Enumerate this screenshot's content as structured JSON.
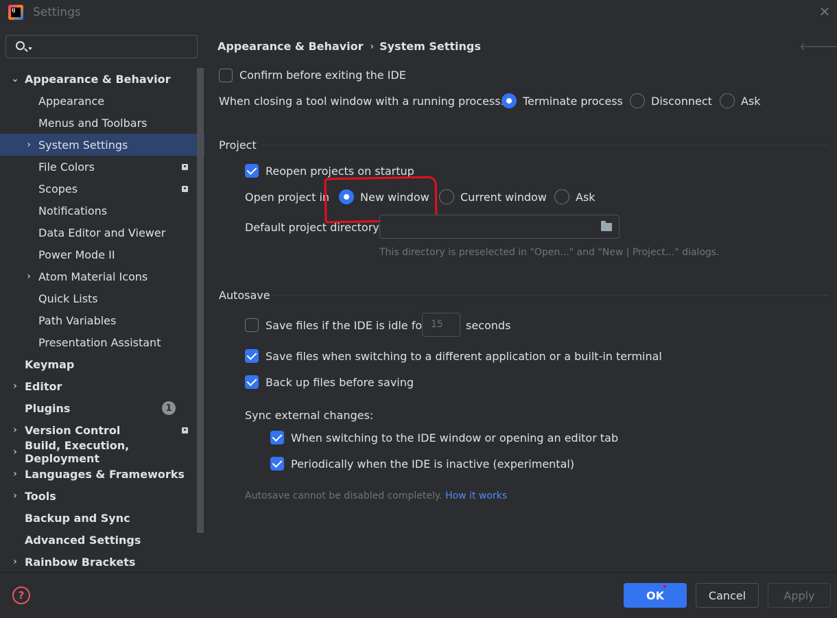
{
  "window": {
    "title": "Settings",
    "close_icon": "close-icon"
  },
  "search": {
    "placeholder": "",
    "value": ""
  },
  "sidebar": {
    "items": [
      {
        "label": "Appearance & Behavior",
        "expanded": true,
        "bold": true
      },
      {
        "label": "Appearance"
      },
      {
        "label": "Menus and Toolbars"
      },
      {
        "label": "System Settings",
        "selected": true
      },
      {
        "label": "File Colors"
      },
      {
        "label": "Scopes"
      },
      {
        "label": "Notifications"
      },
      {
        "label": "Data Editor and Viewer"
      },
      {
        "label": "Power Mode II"
      },
      {
        "label": "Atom Material Icons"
      },
      {
        "label": "Quick Lists"
      },
      {
        "label": "Path Variables"
      },
      {
        "label": "Presentation Assistant"
      },
      {
        "label": "Keymap",
        "bold": true
      },
      {
        "label": "Editor",
        "bold": true
      },
      {
        "label": "Plugins",
        "bold": true,
        "badge": "1"
      },
      {
        "label": "Version Control",
        "bold": true
      },
      {
        "label": "Build, Execution, Deployment",
        "bold": true
      },
      {
        "label": "Languages & Frameworks",
        "bold": true
      },
      {
        "label": "Tools",
        "bold": true
      },
      {
        "label": "Backup and Sync",
        "bold": true
      },
      {
        "label": "Advanced Settings",
        "bold": true
      },
      {
        "label": "Rainbow Brackets",
        "bold": true
      }
    ]
  },
  "breadcrumb": {
    "parent": "Appearance & Behavior",
    "separator": "›",
    "current": "System Settings"
  },
  "general": {
    "confirm_exit": {
      "label": "Confirm before exiting the IDE",
      "checked": false
    },
    "closing_label": "When closing a tool window with a running process:",
    "closing_options": [
      {
        "label": "Terminate process",
        "selected": true
      },
      {
        "label": "Disconnect",
        "selected": false
      },
      {
        "label": "Ask",
        "selected": false
      }
    ]
  },
  "project": {
    "title": "Project",
    "reopen": {
      "label": "Reopen projects on startup",
      "checked": true
    },
    "open_in_label": "Open project in",
    "open_in_options": [
      {
        "label": "New window",
        "selected": true
      },
      {
        "label": "Current window",
        "selected": false
      },
      {
        "label": "Ask",
        "selected": false
      }
    ],
    "dir_label": "Default project directory:",
    "dir_value": "",
    "dir_hint": "This directory is preselected in \"Open...\" and \"New | Project...\" dialogs."
  },
  "autosave": {
    "title": "Autosave",
    "idle": {
      "label": "Save files if the IDE is idle for",
      "checked": false,
      "seconds": "15",
      "suffix": "seconds"
    },
    "switching": {
      "label": "Save files when switching to a different application or a built-in terminal",
      "checked": true
    },
    "backup": {
      "label": "Back up files before saving",
      "checked": true
    },
    "sync_label": "Sync external changes:",
    "sync_window": {
      "label": "When switching to the IDE window or opening an editor tab",
      "checked": true
    },
    "sync_periodic": {
      "label": "Periodically when the IDE is inactive (experimental)",
      "checked": true
    },
    "note": "Autosave cannot be disabled completely.",
    "note_link": "How it works"
  },
  "footer": {
    "ok": "OK",
    "cancel": "Cancel",
    "apply": "Apply"
  },
  "colors": {
    "accent": "#3574f0",
    "selection": "#2e436e",
    "annotation": "#e3101e",
    "link": "#548af7"
  }
}
